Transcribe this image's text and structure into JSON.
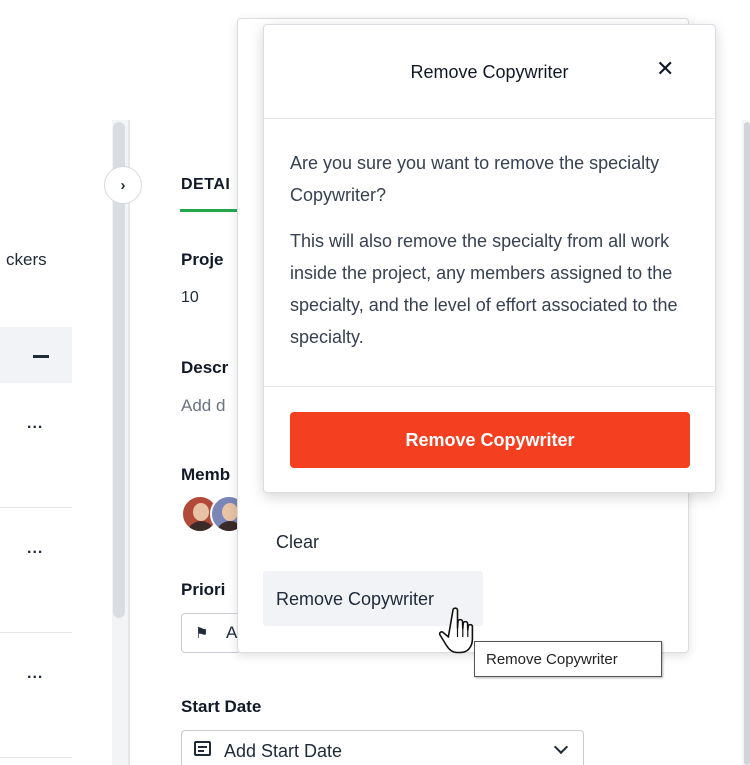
{
  "left_panel": {
    "column_header": "ckers",
    "row_menu": "...",
    "collapse_glyph": "›"
  },
  "details": {
    "tab_label": "DETAI",
    "project_label": "Proje",
    "project_value": "10",
    "description_label": "Descr",
    "description_placeholder": "Add d",
    "members_label": "Memb",
    "priority_label": "Priori",
    "priority_value": "A",
    "start_date_label": "Start Date",
    "start_date_value": "Add Start Date"
  },
  "dropdown": {
    "clear_label": "Clear",
    "remove_label": "Remove Copywriter"
  },
  "modal": {
    "title": "Remove Copywriter",
    "close_glyph": "✕",
    "body_1": "Are you sure you want to remove the specialty Copywriter?",
    "body_2": "This will also remove the specialty from all work inside the project, any members assigned to the specialty, and the level of effort associated to the specialty.",
    "confirm_label": "Remove Copywriter",
    "confirm_color": "#f43f20"
  },
  "tooltip": {
    "text": "Remove Copywriter"
  },
  "icons": [
    "chevron-right-icon",
    "flag-icon",
    "calendar-icon",
    "chevron-down-icon",
    "close-icon",
    "hand-cursor-icon"
  ],
  "colors": {
    "accent_green": "#22a84a",
    "danger_button": "#f43f20"
  }
}
